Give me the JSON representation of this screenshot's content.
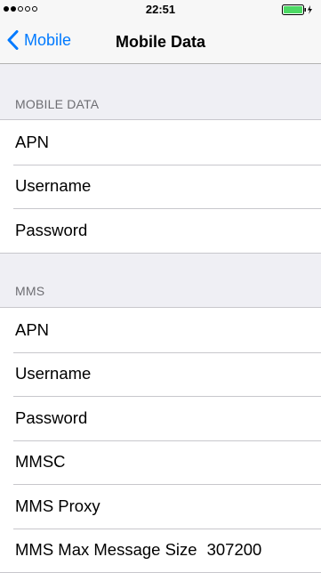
{
  "status_bar": {
    "time": "22:51",
    "signal_strength": {
      "filled": 2,
      "total": 5
    },
    "battery_color": "#4cd964"
  },
  "nav": {
    "back_label": "Mobile",
    "title": "Mobile Data"
  },
  "sections": [
    {
      "header": "MOBILE DATA",
      "rows": [
        {
          "label": "APN",
          "value": ""
        },
        {
          "label": "Username",
          "value": ""
        },
        {
          "label": "Password",
          "value": ""
        }
      ]
    },
    {
      "header": "MMS",
      "rows": [
        {
          "label": "APN",
          "value": ""
        },
        {
          "label": "Username",
          "value": ""
        },
        {
          "label": "Password",
          "value": ""
        },
        {
          "label": "MMSC",
          "value": ""
        },
        {
          "label": "MMS Proxy",
          "value": ""
        },
        {
          "label": "MMS Max Message Size",
          "value": "307200"
        }
      ]
    }
  ],
  "colors": {
    "accent": "#007aff",
    "background": "#efeff4",
    "separator": "#c8c7cc",
    "section_header": "#6d6d72"
  }
}
